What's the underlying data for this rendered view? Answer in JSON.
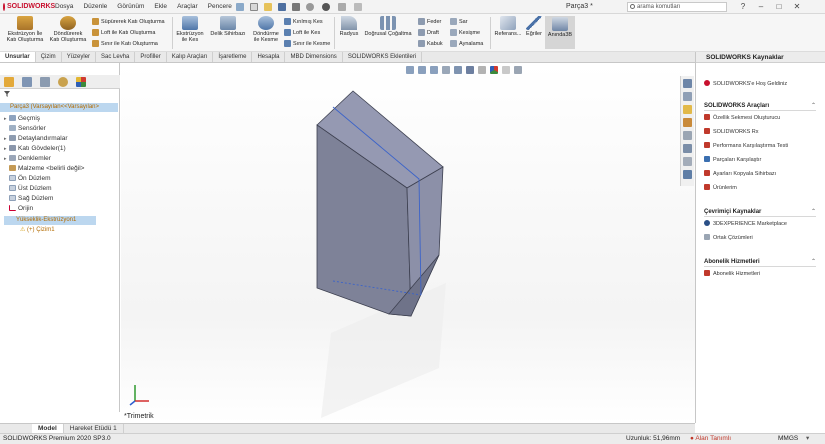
{
  "app": {
    "name": "SOLIDWORKS",
    "document_title": "Parça3 *",
    "search_placeholder": "arama komutları"
  },
  "menu": [
    "Dosya",
    "Düzenle",
    "Görünüm",
    "Ekle",
    "Araçlar",
    "Pencere"
  ],
  "ribbon": {
    "extrude_boss": "Ekstrüzyon İle\nKatı Oluşturma",
    "revolve_boss": "Döndürerek\nKatı Oluşturma",
    "sweep_boss": "Süpürerek Katı Oluşturma",
    "loft_boss": "Loft ile Katı Oluşturma",
    "boundary_boss": "Sınır ile Katı Oluşturma",
    "extrude_cut": "Ekstrüzyon\nile Kes",
    "hole_wizard": "Delik Sihirbazı",
    "revolve_cut": "Döndürme\nile Kesme",
    "sweep_cut": "Kırılmış Kes",
    "loft_cut": "Loft ile Kes",
    "boundary_cut": "Sınır ile Kesme",
    "fillet": "Radyus",
    "linear_pattern": "Doğrusal Çoğaltma",
    "rib": "Feder",
    "draft": "Draft",
    "shell": "Kabuk",
    "wrap": "Sar",
    "intersect": "Kesişme",
    "mirror": "Aynalama",
    "reference": "Referans...",
    "curves": "Eğriler",
    "instant3d": "Anında3B"
  },
  "tabs": [
    "Unsurlar",
    "Çizim",
    "Yüzeyler",
    "Sac Levha",
    "Profiller",
    "Kalıp Araçları",
    "İşaretleme",
    "Hesapla",
    "MBD Dimensions",
    "SOLIDWORKS Eklentileri"
  ],
  "active_tab": "Unsurlar",
  "feature_tree": {
    "root": "Parça3 (Varsayılan<<Varsayılan>",
    "items": [
      {
        "label": "Geçmiş",
        "expand": "▸"
      },
      {
        "label": "Sensörler",
        "expand": ""
      },
      {
        "label": "Detaylandırmalar",
        "expand": "▸"
      },
      {
        "label": "Katı Gövdeler(1)",
        "expand": "▸"
      },
      {
        "label": "Denklemler",
        "expand": "▸"
      },
      {
        "label": "Malzeme <belirli değil>",
        "expand": ""
      },
      {
        "label": "Ön Düzlem",
        "expand": ""
      },
      {
        "label": "Üst Düzlem",
        "expand": ""
      },
      {
        "label": "Sağ Düzlem",
        "expand": ""
      },
      {
        "label": "Orijin",
        "expand": ""
      }
    ],
    "extrude_feature": "Yükseklik-Ekstrüzyon1",
    "sketch": "(+) Çizim1"
  },
  "viewport": {
    "view_name": "*Trimetrik"
  },
  "task_pane": {
    "title": "SOLIDWORKS Kaynaklar",
    "welcome": "SOLIDWORKS'e Hoş Geldiniz",
    "sections": [
      {
        "title": "SOLIDWORKS Araçları",
        "items": [
          "Özellik Sekmesi Oluşturucu",
          "SOLIDWORKS Rx",
          "Performans Karşılaştırma Testi",
          "Parçaları Karşılaştır",
          "Ayarları Kopyala Sihirbazı",
          "Ürünlerim"
        ]
      },
      {
        "title": "Çevrimiçi Kaynaklar",
        "items": [
          "3DEXPERIENCE Marketplace",
          "Ortak Çözümleri"
        ]
      },
      {
        "title": "Abonelik Hizmetleri",
        "items": [
          "Abonelik Hizmetleri"
        ]
      }
    ]
  },
  "bottom_tabs": [
    "Model",
    "Hareket Etüdü 1"
  ],
  "status": {
    "version": "SOLIDWORKS Premium 2020 SP3.0",
    "length": "Uzunluk: 51,96mm",
    "state": "Alan Tanımlı",
    "units": "MMGS"
  },
  "colors": {
    "accent": "#1f5fa8",
    "model_face": "#8a8fa6",
    "selection": "#bcd7ef",
    "warning_text": "#b36b00"
  }
}
